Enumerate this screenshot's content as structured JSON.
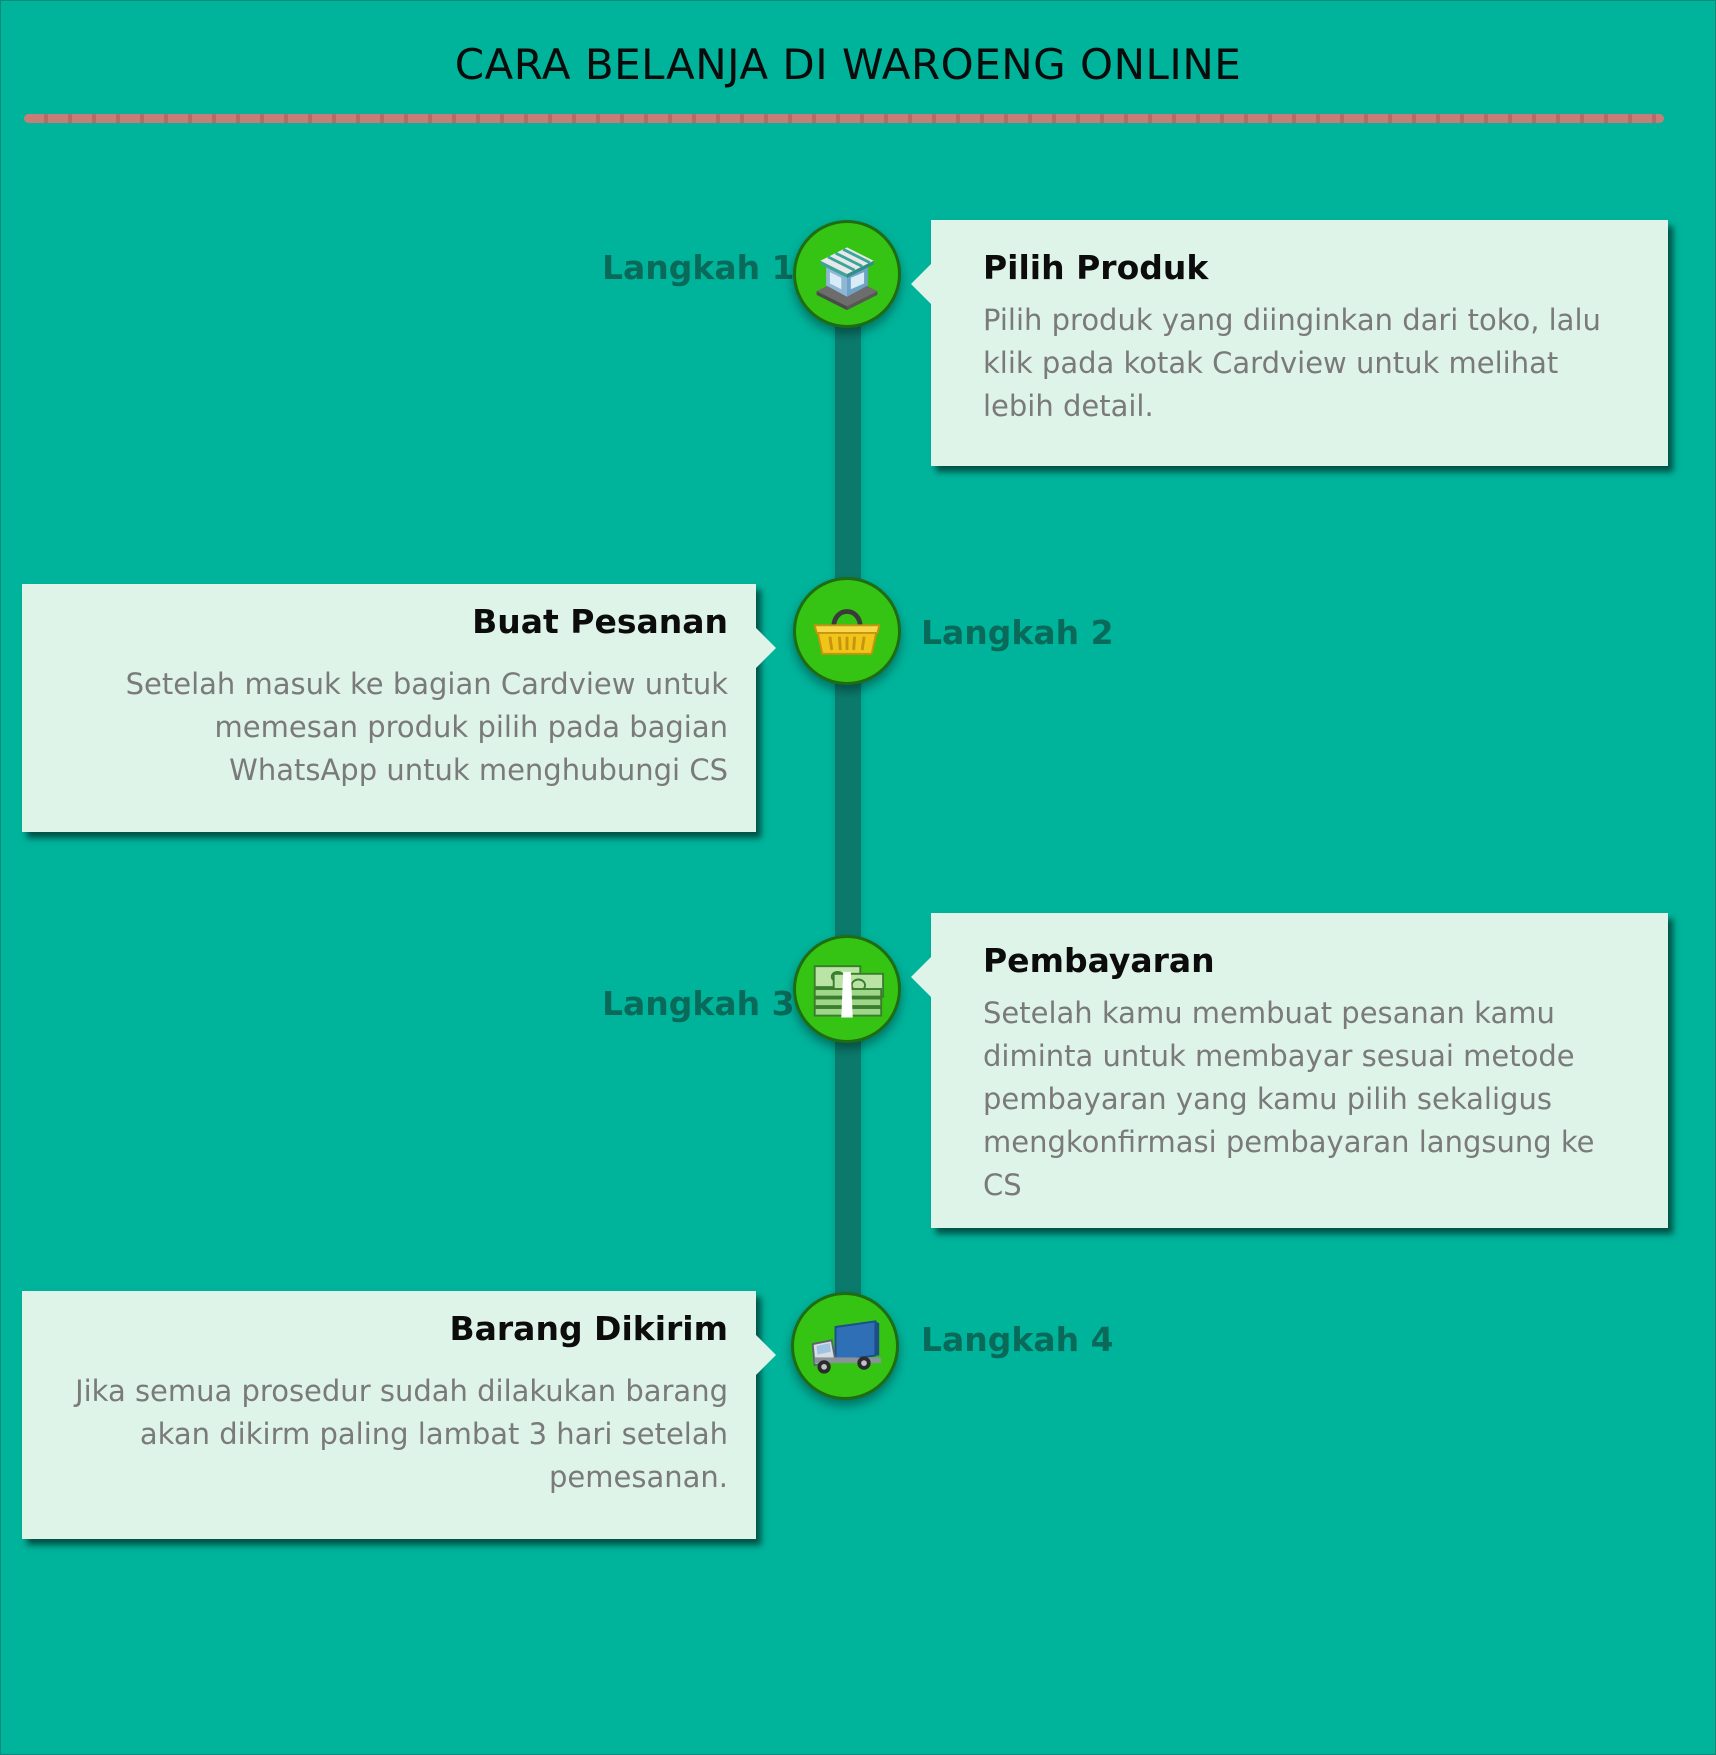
{
  "title": "CARA BELANJA DI WAROENG ONLINE",
  "colors": {
    "background": "#00b39b",
    "timeline": "#0b7a6c",
    "node": "#35c413",
    "card": "#dff4e8",
    "step_label": "#0a6a5a",
    "body_text": "#7a7a7a"
  },
  "steps": [
    {
      "label": "Langkah 1",
      "icon": "shop-icon",
      "title": "Pilih Produk",
      "text": "Pilih produk yang diinginkan dari toko, lalu klik pada kotak Cardview untuk melihat lebih detail."
    },
    {
      "label": "Langkah 2",
      "icon": "basket-icon",
      "title": "Buat Pesanan",
      "text": "Setelah masuk ke bagian Cardview untuk memesan produk pilih pada bagian WhatsApp untuk menghubungi CS"
    },
    {
      "label": "Langkah 3",
      "icon": "money-icon",
      "title": "Pembayaran",
      "text": "Setelah kamu membuat pesanan kamu diminta untuk membayar sesuai metode pembayaran yang kamu pilih sekaligus mengkonfirmasi pembayaran langsung ke CS"
    },
    {
      "label": "Langkah 4",
      "icon": "truck-icon",
      "title": "Barang Dikirim",
      "text": "Jika semua prosedur sudah dilakukan barang akan dikirm paling lambat 3 hari setelah pemesanan."
    }
  ]
}
